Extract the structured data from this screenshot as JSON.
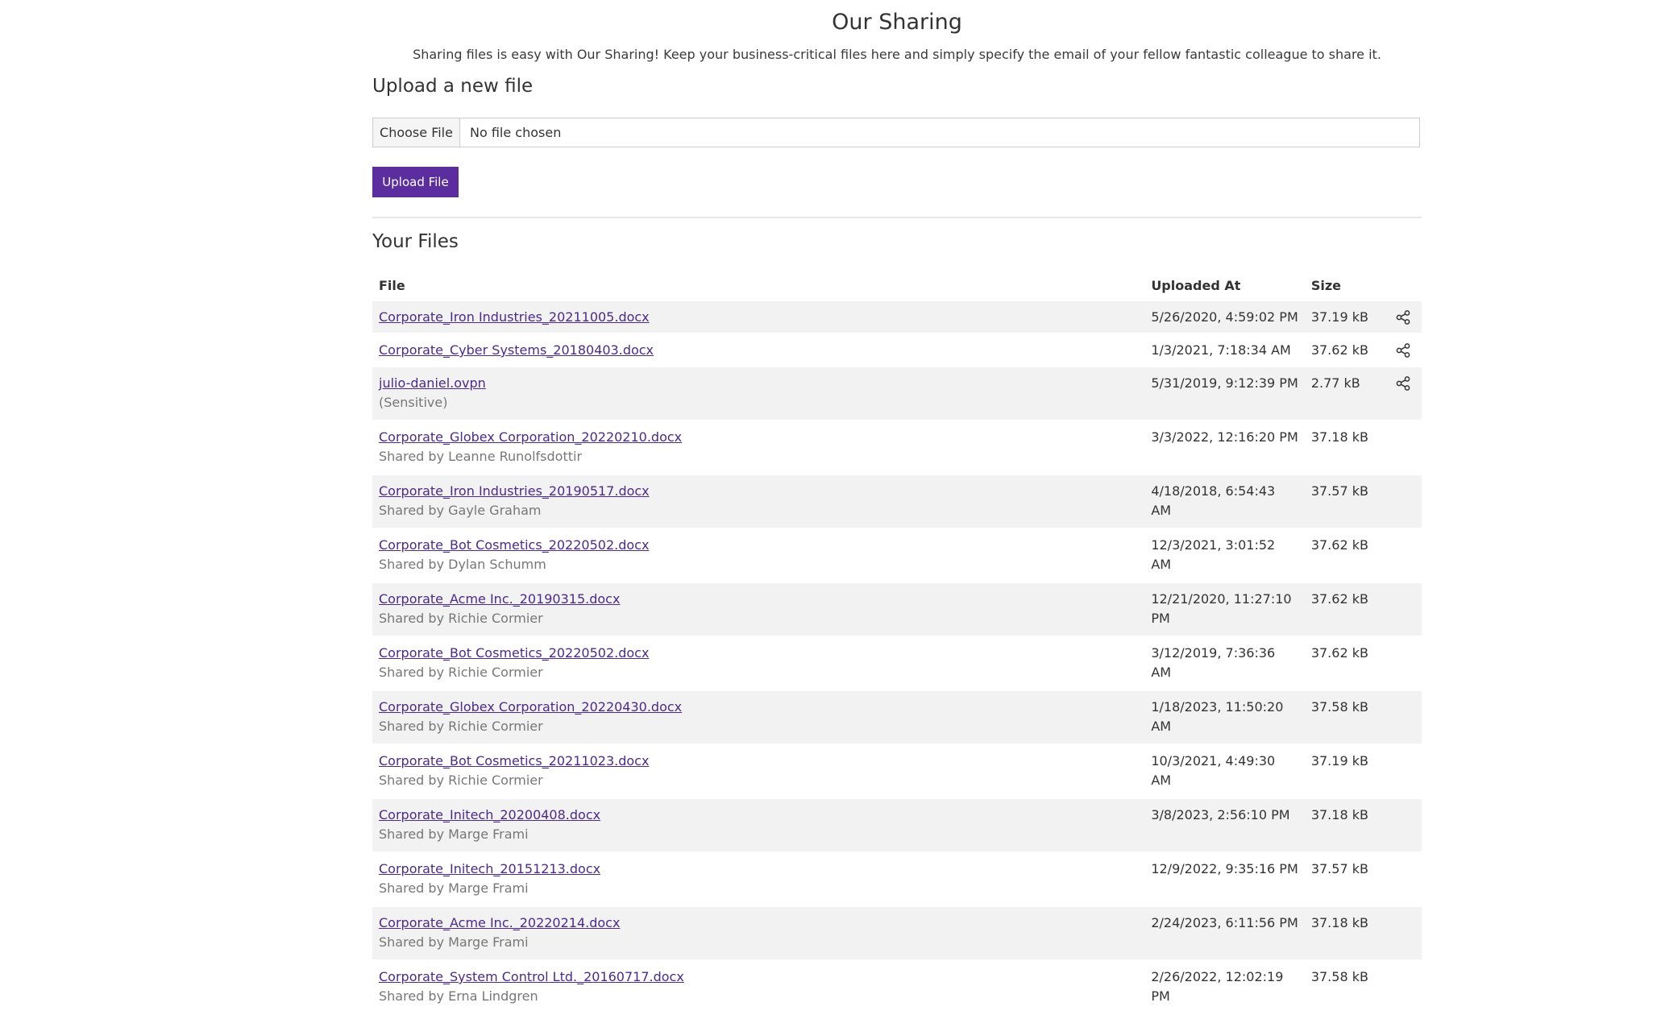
{
  "header": {
    "title": "Our Sharing",
    "description": "Sharing files is easy with Our Sharing! Keep your business-critical files here and simply specify the email of your fellow fantastic colleague to share it."
  },
  "upload": {
    "section_title": "Upload a new file",
    "choose_label": "Choose File",
    "no_file_text": "No file chosen",
    "upload_button": "Upload File"
  },
  "files": {
    "section_title": "Your Files",
    "columns": {
      "file": "File",
      "uploaded_at": "Uploaded At",
      "size": "Size"
    },
    "rows": [
      {
        "name": "Corporate_Iron Industries_20211005.docx",
        "sub": "",
        "uploaded_at": "5/26/2020, 4:59:02 PM",
        "size": "37.19 kB",
        "shareable": true
      },
      {
        "name": "Corporate_Cyber Systems_20180403.docx",
        "sub": "",
        "uploaded_at": "1/3/2021, 7:18:34 AM",
        "size": "37.62 kB",
        "shareable": true
      },
      {
        "name": "julio-daniel.ovpn",
        "sub": "(Sensitive)",
        "uploaded_at": "5/31/2019, 9:12:39 PM",
        "size": "2.77 kB",
        "shareable": true
      },
      {
        "name": "Corporate_Globex Corporation_20220210.docx",
        "sub": "Shared by Leanne Runolfsdottir",
        "uploaded_at": "3/3/2022, 12:16:20 PM",
        "size": "37.18 kB",
        "shareable": false
      },
      {
        "name": "Corporate_Iron Industries_20190517.docx",
        "sub": "Shared by Gayle Graham",
        "uploaded_at": "4/18/2018, 6:54:43 AM",
        "size": "37.57 kB",
        "shareable": false
      },
      {
        "name": "Corporate_Bot Cosmetics_20220502.docx",
        "sub": "Shared by Dylan Schumm",
        "uploaded_at": "12/3/2021, 3:01:52 AM",
        "size": "37.62 kB",
        "shareable": false
      },
      {
        "name": "Corporate_Acme Inc._20190315.docx",
        "sub": "Shared by Richie Cormier",
        "uploaded_at": "12/21/2020, 11:27:10 PM",
        "size": "37.62 kB",
        "shareable": false
      },
      {
        "name": "Corporate_Bot Cosmetics_20220502.docx",
        "sub": "Shared by Richie Cormier",
        "uploaded_at": "3/12/2019, 7:36:36 AM",
        "size": "37.62 kB",
        "shareable": false
      },
      {
        "name": "Corporate_Globex Corporation_20220430.docx",
        "sub": "Shared by Richie Cormier",
        "uploaded_at": "1/18/2023, 11:50:20 AM",
        "size": "37.58 kB",
        "shareable": false
      },
      {
        "name": "Corporate_Bot Cosmetics_20211023.docx",
        "sub": "Shared by Richie Cormier",
        "uploaded_at": "10/3/2021, 4:49:30 AM",
        "size": "37.19 kB",
        "shareable": false
      },
      {
        "name": "Corporate_Initech_20200408.docx",
        "sub": "Shared by Marge Frami",
        "uploaded_at": "3/8/2023, 2:56:10 PM",
        "size": "37.18 kB",
        "shareable": false
      },
      {
        "name": "Corporate_Initech_20151213.docx",
        "sub": "Shared by Marge Frami",
        "uploaded_at": "12/9/2022, 9:35:16 PM",
        "size": "37.57 kB",
        "shareable": false
      },
      {
        "name": "Corporate_Acme Inc._20220214.docx",
        "sub": "Shared by Marge Frami",
        "uploaded_at": "2/24/2023, 6:11:56 PM",
        "size": "37.18 kB",
        "shareable": false
      },
      {
        "name": "Corporate_System Control Ltd._20160717.docx",
        "sub": "Shared by Erna Lindgren",
        "uploaded_at": "2/26/2022, 12:02:19 PM",
        "size": "37.58 kB",
        "shareable": false
      }
    ]
  },
  "icons": {
    "share": "share-icon"
  },
  "colors": {
    "accent": "#5b2d9f",
    "link": "#4b2a8a",
    "row_stripe": "#f2f2f2"
  }
}
